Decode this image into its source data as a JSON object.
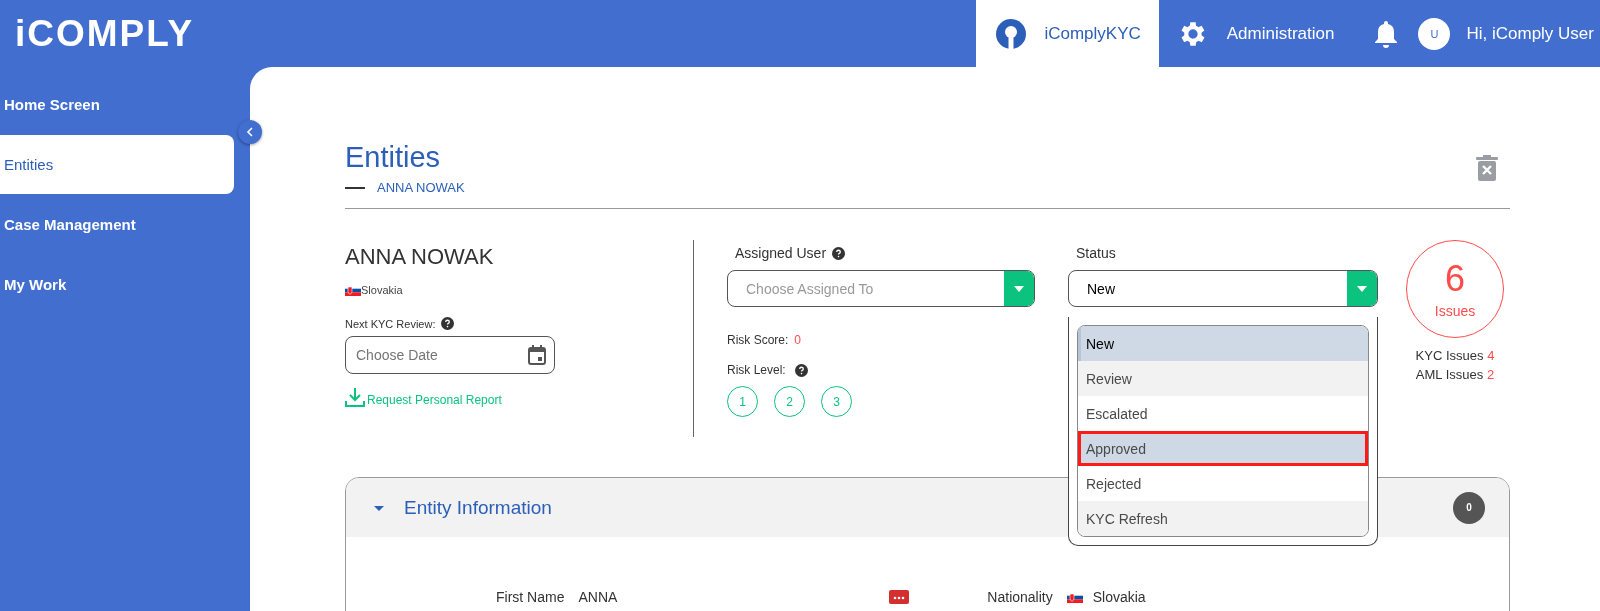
{
  "header": {
    "logo": "iCOMPLY",
    "nav": [
      {
        "label": "iComplyKYC",
        "selected": true
      },
      {
        "label": "Administration",
        "selected": false
      }
    ],
    "user": {
      "avatar": "U",
      "greeting": "Hi, iComply User"
    }
  },
  "sidebar": {
    "items": [
      {
        "label": "Home Screen",
        "selected": false
      },
      {
        "label": "Entities",
        "selected": true
      },
      {
        "label": "Case Management",
        "selected": false
      },
      {
        "label": "My Work",
        "selected": false
      }
    ]
  },
  "page": {
    "title": "Entities",
    "breadcrumb": "ANNA NOWAK"
  },
  "entity": {
    "name": "ANNA NOWAK",
    "country": "Slovakia",
    "review_label": "Next KYC Review:",
    "date_placeholder": "Choose Date",
    "report_link": "Request Personal Report"
  },
  "assigned": {
    "label": "Assigned User",
    "placeholder": "Choose Assigned To"
  },
  "risk": {
    "score_label": "Risk Score:",
    "score": "0",
    "level_label": "Risk Level:",
    "levels": [
      "1",
      "2",
      "3"
    ]
  },
  "status": {
    "label": "Status",
    "value": "New",
    "expanded": true,
    "options": [
      {
        "label": "New",
        "selected": true,
        "outlined": false
      },
      {
        "label": "Review",
        "selected": false,
        "outlined": false
      },
      {
        "label": "Escalated",
        "selected": false,
        "outlined": false
      },
      {
        "label": "Approved",
        "selected": false,
        "outlined": true
      },
      {
        "label": "Rejected",
        "selected": false,
        "outlined": false
      },
      {
        "label": "KYC Refresh",
        "selected": false,
        "outlined": false
      }
    ]
  },
  "issues": {
    "count": "6",
    "label": "Issues",
    "rows": [
      {
        "label": "KYC Issues",
        "count": "4"
      },
      {
        "label": "AML Issues",
        "count": "2"
      }
    ]
  },
  "section": {
    "title": "Entity Information",
    "expanded": true,
    "badge": "0",
    "fields": [
      {
        "label": "First Name",
        "value": "ANNA",
        "kind": "text"
      },
      {
        "label": "Nationality",
        "value": "Slovakia",
        "kind": "country"
      }
    ]
  }
}
